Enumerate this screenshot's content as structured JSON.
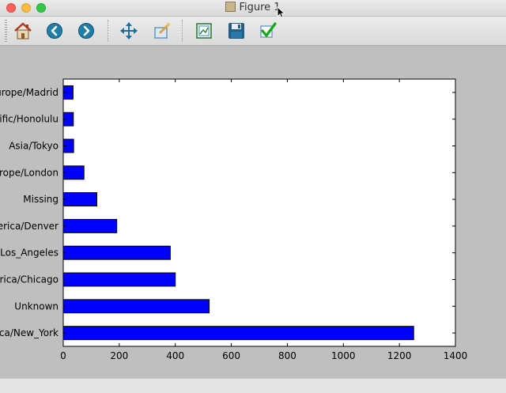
{
  "window": {
    "title": "Figure 1"
  },
  "toolbar": {
    "buttons": [
      {
        "name": "home-button",
        "icon": "home-icon"
      },
      {
        "name": "back-button",
        "icon": "back-arrow-icon"
      },
      {
        "name": "forward-button",
        "icon": "forward-arrow-icon"
      },
      {
        "name": "pan-button",
        "icon": "move-arrows-icon"
      },
      {
        "name": "zoom-button",
        "icon": "zoom-rect-icon"
      },
      {
        "name": "subplots-button",
        "icon": "subplots-icon"
      },
      {
        "name": "save-button",
        "icon": "floppy-disk-icon"
      },
      {
        "name": "edit-button",
        "icon": "checkmark-icon"
      }
    ]
  },
  "chart_data": {
    "type": "bar",
    "orientation": "horizontal",
    "categories": [
      "America/New_York",
      "Unknown",
      "America/Chicago",
      "America/Los_Angeles",
      "America/Denver",
      "Missing",
      "Europe/London",
      "Asia/Tokyo",
      "Pacific/Honolulu",
      "Europe/Madrid"
    ],
    "values": [
      1251,
      521,
      400,
      382,
      191,
      120,
      74,
      37,
      36,
      35
    ],
    "xlim": [
      0,
      1400
    ],
    "xticks": [
      0,
      200,
      400,
      600,
      800,
      1000,
      1200,
      1400
    ],
    "bar_color": "#0000ff",
    "grid": false,
    "title": "",
    "xlabel": "",
    "ylabel": ""
  }
}
